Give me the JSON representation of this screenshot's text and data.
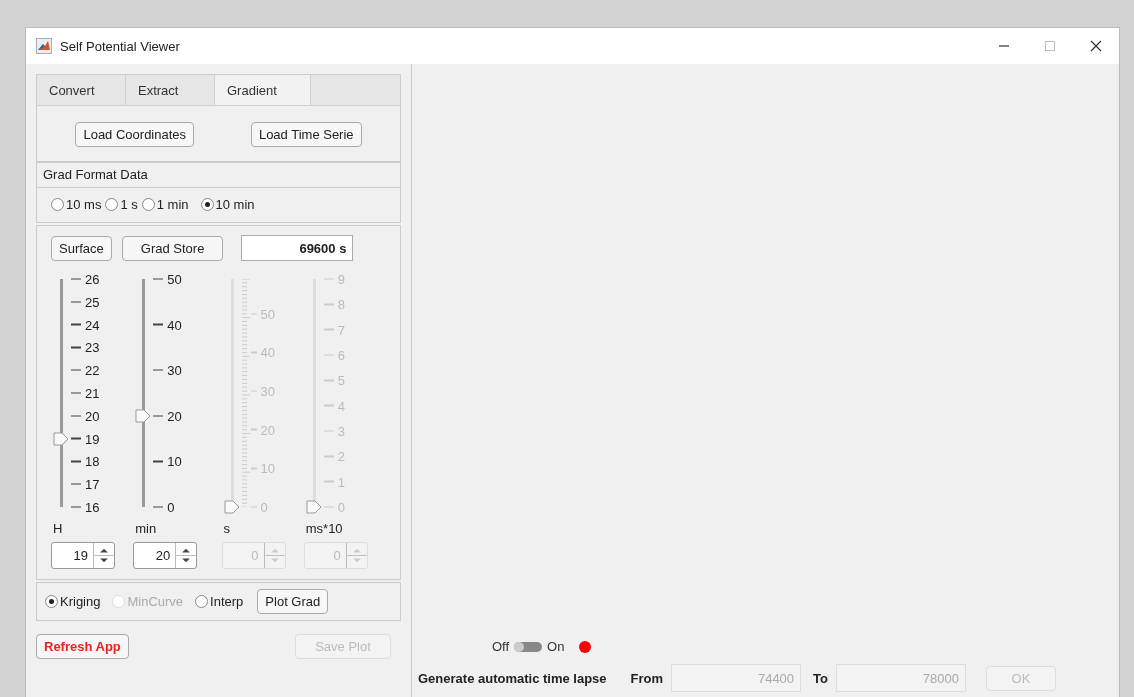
{
  "window": {
    "title": "Self Potential Viewer"
  },
  "tabs": [
    {
      "label": "Convert",
      "selected": false
    },
    {
      "label": "Extract",
      "selected": false
    },
    {
      "label": "Gradient",
      "selected": true
    }
  ],
  "load_buttons": [
    "Load Coordinates",
    "Load Time Serie"
  ],
  "format_panel": {
    "title": "Grad Format Data",
    "options": [
      {
        "label": "10 ms",
        "selected": false
      },
      {
        "label": "1 s",
        "selected": false
      },
      {
        "label": "1 min",
        "selected": false
      },
      {
        "label": "10 min",
        "selected": true
      }
    ]
  },
  "slider_panel": {
    "buttons": [
      "Surface",
      "Grad Store"
    ],
    "time_field": "69600 s",
    "sliders": [
      {
        "label": "H",
        "ticks": [
          "26",
          "25",
          "24",
          "23",
          "22",
          "21",
          "20",
          "19",
          "18",
          "17",
          "16"
        ],
        "level": 0.3,
        "disabled": false,
        "kind": "plain",
        "spinner": "19"
      },
      {
        "label": "min",
        "ticks": [
          "50",
          "40",
          "30",
          "20",
          "10",
          "0"
        ],
        "level": 0.4,
        "disabled": false,
        "kind": "plain",
        "spinner": "20"
      },
      {
        "label": "s",
        "ticks": [
          "50",
          "40",
          "30",
          "20",
          "10",
          "0"
        ],
        "level": 0,
        "disabled": true,
        "kind": "fine",
        "spinner": "0"
      },
      {
        "label": "ms*10",
        "ticks": [
          "9",
          "8",
          "7",
          "6",
          "5",
          "4",
          "3",
          "2",
          "1",
          "0"
        ],
        "level": 0,
        "disabled": true,
        "kind": "plain",
        "spinner": "0"
      }
    ]
  },
  "method_panel": {
    "options": [
      {
        "label": "Kriging",
        "selected": true,
        "disabled": false
      },
      {
        "label": "MinCurve",
        "selected": false,
        "disabled": true
      },
      {
        "label": "Interp",
        "selected": false,
        "disabled": false
      }
    ],
    "plot_button": "Plot Grad"
  },
  "refresh_button": "Refresh App",
  "save_button": {
    "label": "Save Plot",
    "disabled": true
  },
  "timelapse": {
    "off_label": "Off",
    "on_label": "On",
    "on": false,
    "lamp_lit": true,
    "label": "Generate automatic time lapse",
    "from_label": "From",
    "from_value": "74400",
    "to_label": "To",
    "to_value": "78000",
    "ok_button": {
      "label": "OK",
      "disabled": true
    }
  }
}
